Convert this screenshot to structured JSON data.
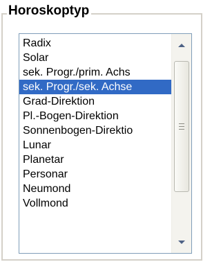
{
  "group": {
    "title": "Horoskoptyp"
  },
  "list": {
    "items": [
      {
        "label": "Radix",
        "selected": false
      },
      {
        "label": "Solar",
        "selected": false
      },
      {
        "label": "sek. Progr./prim. Achs",
        "selected": false
      },
      {
        "label": "sek. Progr./sek. Achse",
        "selected": true
      },
      {
        "label": "Grad-Direktion",
        "selected": false
      },
      {
        "label": "Pl.-Bogen-Direktion",
        "selected": false
      },
      {
        "label": "Sonnenbogen-Direktio",
        "selected": false
      },
      {
        "label": "Lunar",
        "selected": false
      },
      {
        "label": "Planetar",
        "selected": false
      },
      {
        "label": "Personar",
        "selected": false
      },
      {
        "label": "Neumond",
        "selected": false
      },
      {
        "label": "Vollmond",
        "selected": false
      }
    ]
  },
  "scrollbar": {
    "up_icon": "arrow-up-icon",
    "down_icon": "arrow-down-icon",
    "grip_icon": "grip-icon"
  },
  "colors": {
    "selection": "#316ac5",
    "selection_text": "#ffffff",
    "border": "#7f9db9",
    "group_border": "#d4d0c8"
  }
}
